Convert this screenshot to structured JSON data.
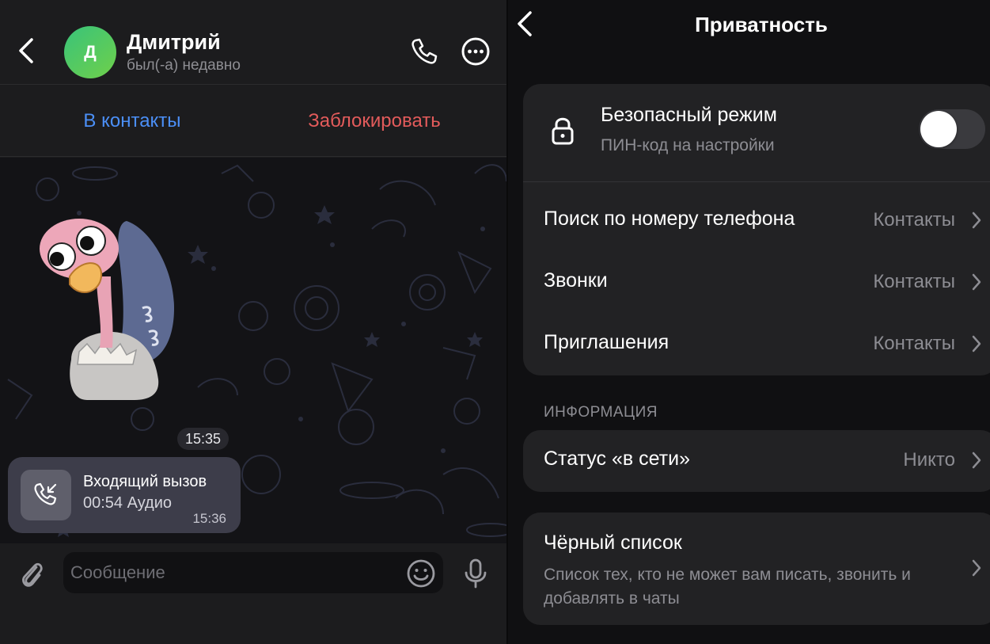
{
  "chat": {
    "header": {
      "avatar_initial": "Д",
      "contact_name": "Дмитрий",
      "contact_status": "был(-а) недавно"
    },
    "actions": {
      "add_contact": "В контакты",
      "block": "Заблокировать"
    },
    "messages": {
      "sticker_time": "15:35",
      "call": {
        "title": "Входящий вызов",
        "details": "00:54 Аудио",
        "time": "15:36"
      }
    },
    "composer": {
      "placeholder": "Сообщение"
    }
  },
  "privacy": {
    "title": "Приватность",
    "safe_mode": {
      "title": "Безопасный режим",
      "subtitle": "ПИН-код на настройки",
      "enabled": false
    },
    "rows": [
      {
        "label": "Поиск по номеру телефона",
        "value": "Контакты"
      },
      {
        "label": "Звонки",
        "value": "Контакты"
      },
      {
        "label": "Приглашения",
        "value": "Контакты"
      }
    ],
    "info_section": {
      "header": "ИНФОРМАЦИЯ",
      "online_status": {
        "label": "Статус «в сети»",
        "value": "Никто"
      }
    },
    "blacklist": {
      "title": "Чёрный список",
      "description": "Список тех, кто не может вам писать, звонить и добавлять в чаты"
    }
  },
  "colors": {
    "accent_blue": "#4b8ff7",
    "danger_red": "#e35b5b",
    "avatar_green": "#39c37a"
  }
}
